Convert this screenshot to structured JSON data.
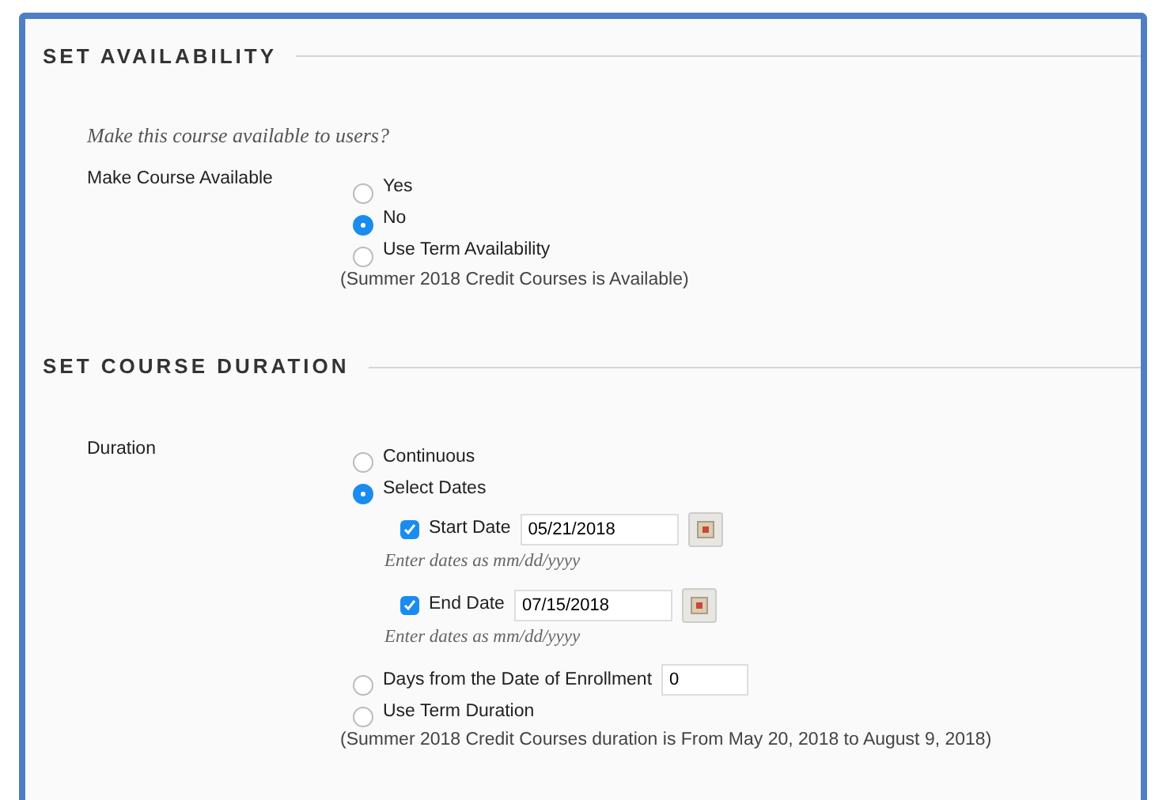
{
  "sections": [
    {
      "title": "SET AVAILABILITY",
      "question": "Make this course available to users?",
      "label": "Make Course Available",
      "options": [
        {
          "kind": "plain",
          "label": "Yes",
          "selected": false
        },
        {
          "kind": "plain",
          "label": "No",
          "selected": true
        },
        {
          "kind": "plain",
          "label": "Use Term Availability",
          "selected": false
        }
      ],
      "note": "(Summer 2018 Credit Courses is Available)"
    },
    {
      "title": "SET COURSE DURATION",
      "label": "Duration",
      "options": [
        {
          "kind": "plain",
          "label": "Continuous",
          "selected": false
        },
        {
          "kind": "dates",
          "label": "Select Dates",
          "selected": true,
          "dates": [
            {
              "label": "Start Date",
              "checked": true,
              "value": "05/21/2018",
              "hint": "Enter dates as mm/dd/yyyy"
            },
            {
              "label": "End Date",
              "checked": true,
              "value": "07/15/2018",
              "hint": "Enter dates as mm/dd/yyyy"
            }
          ]
        },
        {
          "kind": "input",
          "label": "Days from the Date of Enrollment",
          "selected": false,
          "value": "0"
        },
        {
          "kind": "plain",
          "label": "Use Term Duration",
          "selected": false
        }
      ],
      "note": "(Summer 2018 Credit Courses duration is From May 20, 2018 to August 9, 2018)"
    }
  ]
}
